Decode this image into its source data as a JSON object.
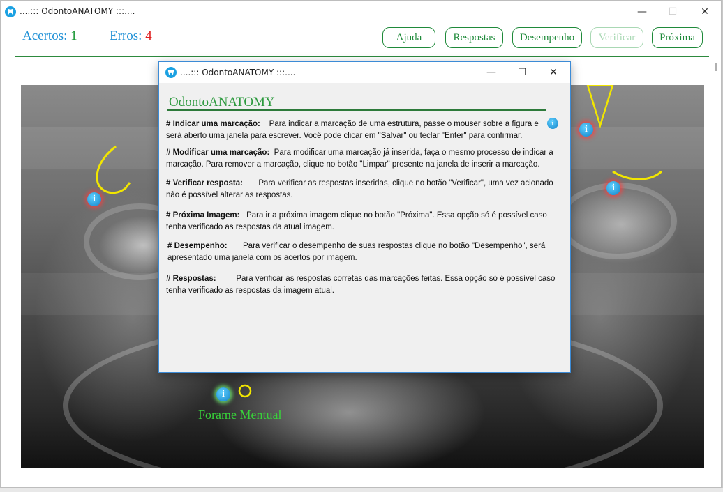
{
  "window": {
    "title": "....::: OdontoANATOMY :::...."
  },
  "score": {
    "acertos_label": "Acertos:",
    "acertos_value": "1",
    "erros_label": "Erros:",
    "erros_value": "4"
  },
  "toolbar": {
    "ajuda": "Ajuda",
    "respostas": "Respostas",
    "desempenho": "Desempenho",
    "verificar": "Verificar",
    "proxima": "Próxima"
  },
  "image": {
    "marker_glyph": "i",
    "forame_label": "Forame Mentual"
  },
  "dialog": {
    "title": "....::: OdontoANATOMY :::....",
    "heading": "OdontoANATOMY",
    "items": [
      {
        "label": "# Indicar uma marcação:",
        "text": "Para indicar a marcação de uma estrutura, passe o mouser sobre a figura e será aberto uma janela para escrever. Você pode clicar em \"Salvar\" ou teclar \"Enter\" para confirmar."
      },
      {
        "label": "# Modificar uma marcação:",
        "text": "Para modificar uma marcação já inserida, faça o mesmo processo de indicar a marcação. Para remover a marcação, clique no botão \"Limpar\" presente na janela de inserir a marcação."
      },
      {
        "label": "# Verificar resposta:",
        "text": "Para verificar as respostas inseridas, clique no botão \"Verificar\", uma vez acionado não é possível alterar as respostas."
      },
      {
        "label": "# Próxima Imagem:",
        "text": "Para ir a próxima imagem clique no botão \"Próxima\". Essa opção só é possível caso tenha verificado as respostas da atual imagem."
      },
      {
        "label": "# Desempenho:",
        "text": "Para verificar o desempenho de suas respostas clique no botão \"Desempenho\", será apresentado uma janela com os acertos por imagem."
      },
      {
        "label": "# Respostas:",
        "text": "Para verificar as respostas corretas das marcações feitas. Essa opção só é possível caso tenha verificado as respostas da imagem atual."
      }
    ]
  },
  "colors": {
    "accent_green": "#1f8a3a",
    "score_label_blue": "#1e90d6",
    "error_red": "#e02020",
    "annotation_yellow": "#f2e600",
    "forame_green": "#38d33a"
  },
  "icons": {
    "app": "tooth-icon",
    "marker": "info-icon"
  }
}
